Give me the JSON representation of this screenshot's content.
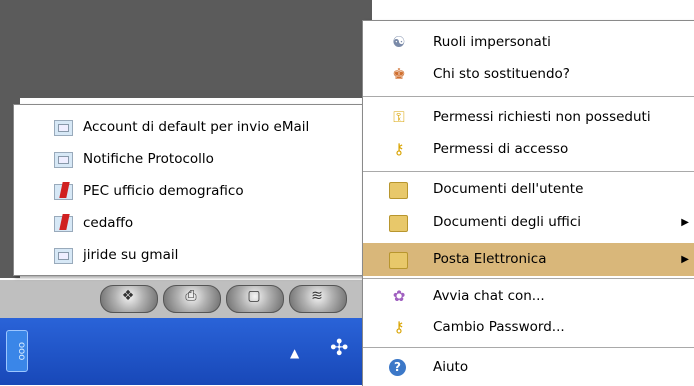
{
  "submenu": {
    "items": [
      {
        "label": "Account di default per invio eMail",
        "icon": "mail-account-icon"
      },
      {
        "label": "Notifiche Protocollo",
        "icon": "mail-account-icon"
      },
      {
        "label": "PEC ufficio demografico",
        "icon": "pec-mail-icon"
      },
      {
        "label": "cedaffo",
        "icon": "pec-mail-icon"
      },
      {
        "label": "jiride su gmail",
        "icon": "mail-account-icon"
      }
    ]
  },
  "main_menu": {
    "items": [
      {
        "label": "Ruoli impersonati",
        "icon": "masks-icon"
      },
      {
        "label": "Chi sto sostituendo?",
        "icon": "users-icon"
      },
      {
        "label": "Permessi richiesti non posseduti",
        "icon": "key-warning-icon"
      },
      {
        "label": "Permessi di accesso",
        "icon": "keys-icon"
      },
      {
        "label": "Documenti dell'utente",
        "icon": "folder-icon"
      },
      {
        "label": "Documenti degli uffici",
        "icon": "folder-icon",
        "has_submenu": true
      },
      {
        "label": "Posta Elettronica",
        "icon": "folder-icon",
        "has_submenu": true,
        "highlighted": true
      },
      {
        "label": "Avvia chat con...",
        "icon": "chat-icon"
      },
      {
        "label": "Cambio Password...",
        "icon": "keys-icon"
      },
      {
        "label": "Aiuto",
        "icon": "help-icon"
      }
    ]
  },
  "taskbar": {
    "tab_text": "ooo",
    "tray_arrow": "▲"
  },
  "colors": {
    "highlight": "#d9b77a",
    "desktop": "#5b5b5b",
    "taskbar": "#2a63d8"
  }
}
